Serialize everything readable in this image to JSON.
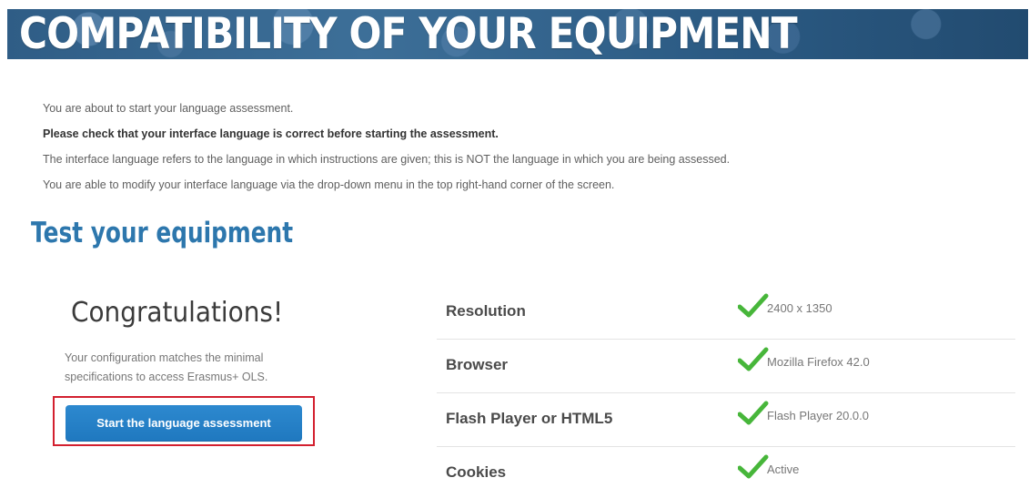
{
  "banner": {
    "title": "COMPATIBILITY OF YOUR EQUIPMENT"
  },
  "intro": {
    "line1": "You are about to start your language assessment.",
    "line2": "Please check that your interface language is correct before starting the assessment.",
    "line3": "The interface language refers to the language in which instructions are given; this is NOT the language in which you are being assessed.",
    "line4": "You are able to modify your interface language via the drop-down menu in the top right-hand corner of the screen."
  },
  "section": {
    "title": "Test your equipment"
  },
  "result": {
    "heading": "Congratulations!",
    "message": "Your configuration matches the minimal specifications to access Erasmus+ OLS.",
    "button_label": "Start the language assessment"
  },
  "checks": [
    {
      "label": "Resolution",
      "value": "2400 x 1350",
      "status": "passed",
      "icon": "check-icon"
    },
    {
      "label": "Browser",
      "value": "Mozilla Firefox 42.0",
      "status": "passed",
      "icon": "check-icon"
    },
    {
      "label": "Flash Player or HTML5",
      "value": "Flash Player 20.0.0",
      "status": "passed",
      "icon": "check-icon"
    },
    {
      "label": "Cookies",
      "value": "Active",
      "status": "passed",
      "icon": "check-icon"
    }
  ],
  "colors": {
    "accent": "#2d77ad",
    "button": "#1f78bf",
    "highlight": "#d3202f",
    "check": "#47b63a"
  }
}
